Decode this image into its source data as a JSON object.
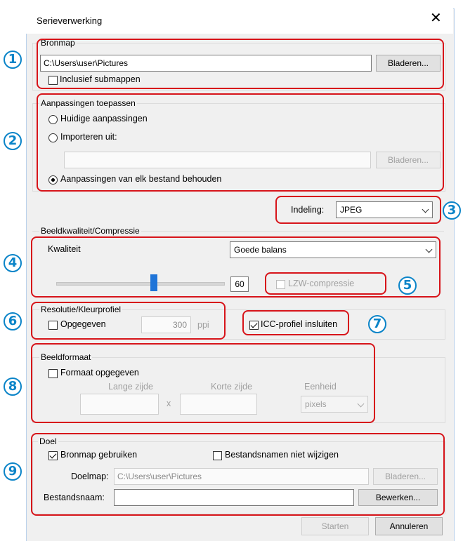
{
  "window": {
    "title": "Serieverwerking",
    "close_icon": "close-icon"
  },
  "bronmap": {
    "group_label": "Bronmap",
    "path": "C:\\Users\\user\\Pictures",
    "browse_label": "Bladeren...",
    "include_sub_label": "Inclusief submappen",
    "include_sub_checked": false
  },
  "adjust": {
    "group_label": "Aanpassingen toepassen",
    "current_label": "Huidige aanpassingen",
    "import_label": "Importeren uit:",
    "import_path": "",
    "browse_label": "Bladeren...",
    "keep_label": "Aanpassingen van elk bestand behouden",
    "selected": "keep"
  },
  "format": {
    "label": "Indeling:",
    "value": "JPEG"
  },
  "quality": {
    "group_label": "Beeldkwaliteit/Compressie",
    "quality_label": "Kwaliteit",
    "quality_value": "Goede balans",
    "slider_value": "60",
    "slider_fraction": 0.58,
    "lzw_label": "LZW-compressie",
    "lzw_checked": false
  },
  "resolution": {
    "group_label": "Resolutie/Kleurprofiel",
    "specified_label": "Opgegeven",
    "specified_checked": false,
    "value": "300",
    "unit": "ppi",
    "icc_label": "ICC-profiel insluiten",
    "icc_checked": true
  },
  "imagesize": {
    "group_label": "Beeldformaat",
    "specified_label": "Formaat opgegeven",
    "specified_checked": false,
    "long_label": "Lange zijde",
    "short_label": "Korte zijde",
    "unit_label": "Eenheid",
    "times": "x",
    "long_value": "",
    "short_value": "",
    "unit_value": "pixels"
  },
  "destination": {
    "group_label": "Doel",
    "use_source_label": "Bronmap gebruiken",
    "use_source_checked": true,
    "keep_names_label": "Bestandsnamen niet wijzigen",
    "keep_names_checked": false,
    "folder_label": "Doelmap:",
    "folder_value": "C:\\Users\\user\\Pictures",
    "browse_label": "Bladeren...",
    "filename_label": "Bestandsnaam:",
    "filename_value": "",
    "edit_label": "Bewerken..."
  },
  "footer": {
    "start_label": "Starten",
    "cancel_label": "Annuleren"
  },
  "callouts": [
    "1",
    "2",
    "3",
    "4",
    "5",
    "6",
    "7",
    "8",
    "9"
  ],
  "colors": {
    "callout_red": "#d7141a",
    "callout_blue": "#0a84c8"
  }
}
